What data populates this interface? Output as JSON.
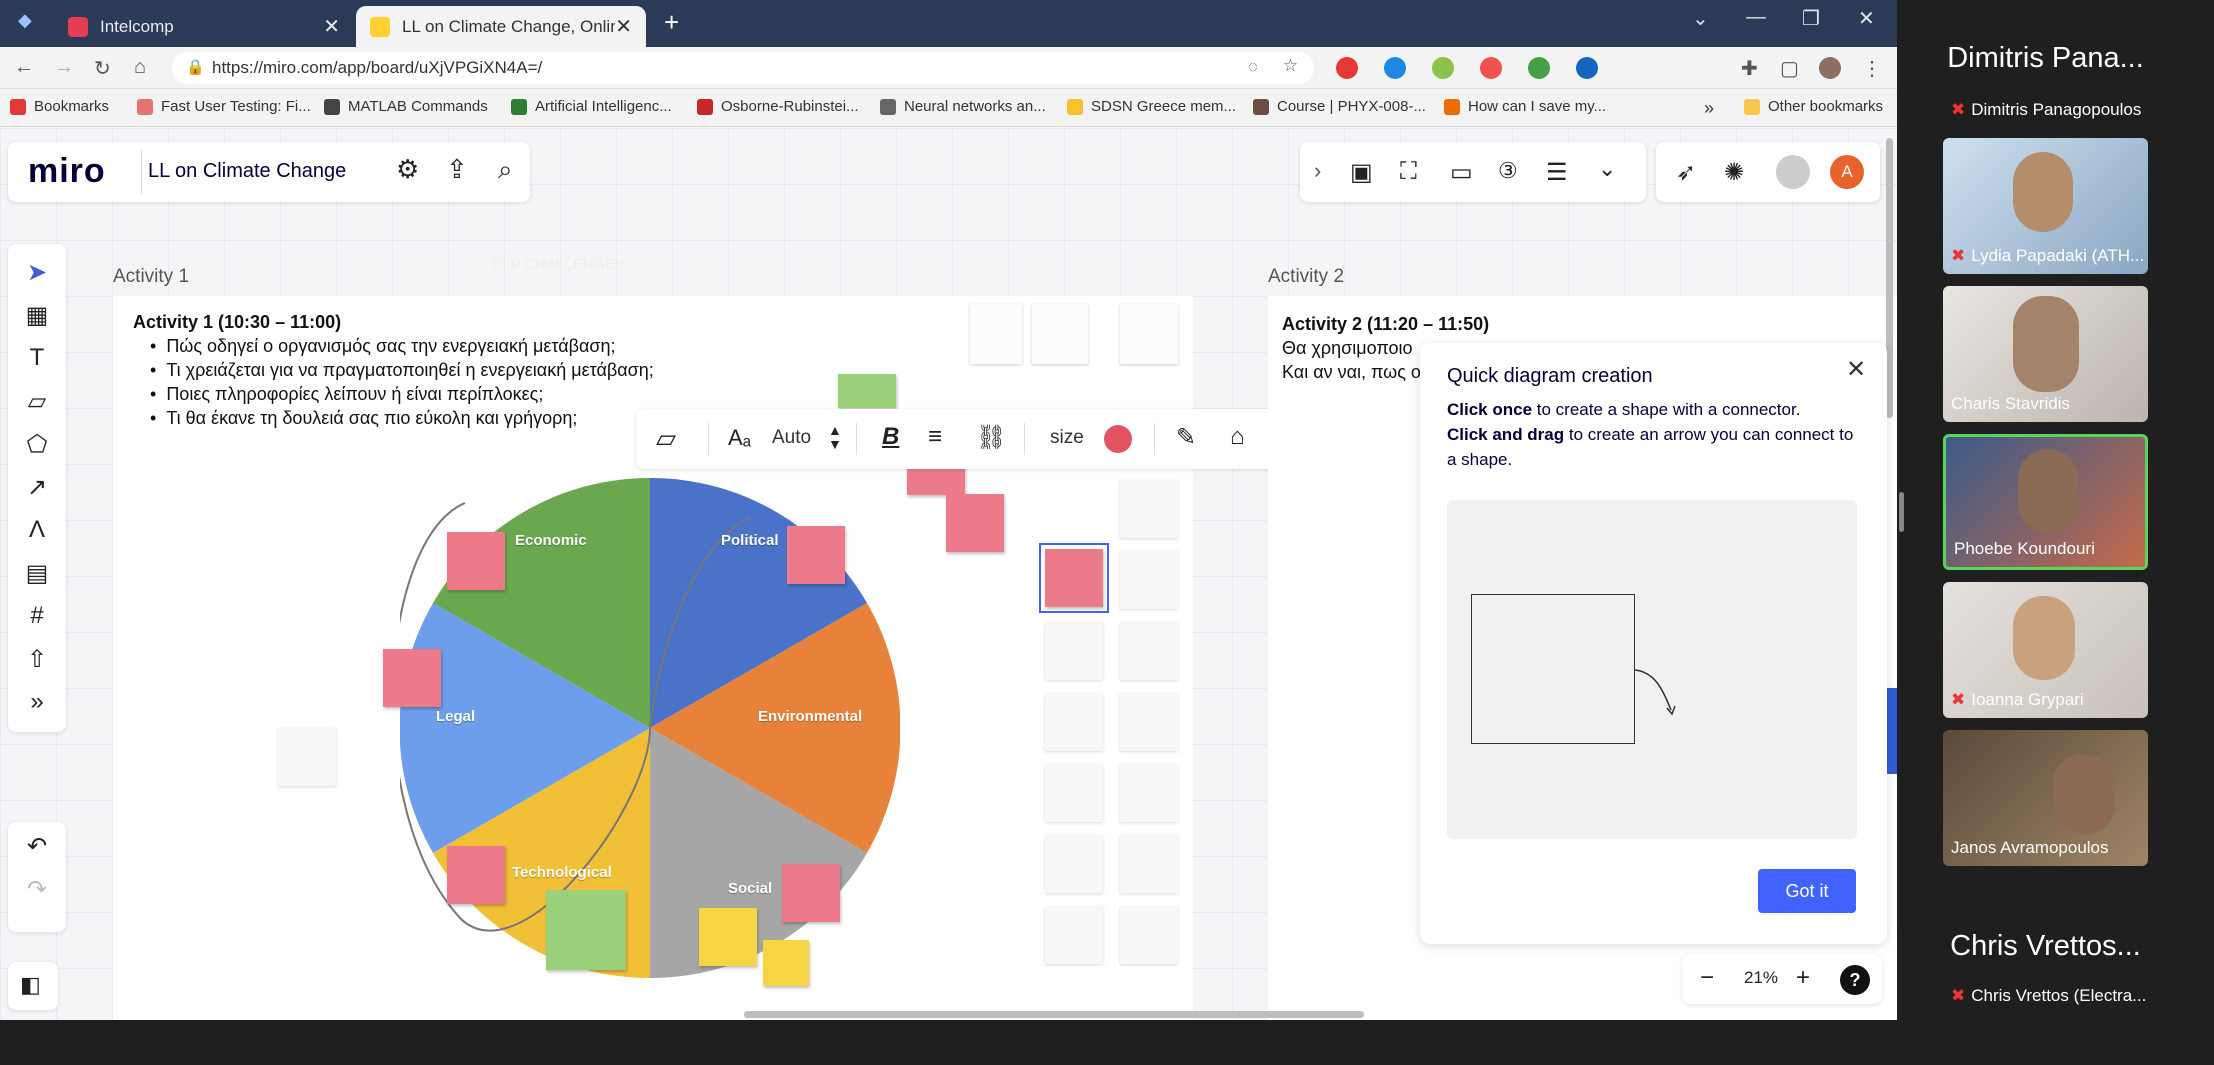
{
  "tabs": [
    {
      "label": "Intelcomp",
      "close": "✕",
      "favicon_color": "#e73c56"
    },
    {
      "label": "LL on Climate Change, Online W",
      "close": "✕",
      "favicon_color": "#ffd02f"
    }
  ],
  "new_tab": "+",
  "window_controls": {
    "dropdown": "⌄",
    "minimize": "—",
    "restore": "❐",
    "close": "✕"
  },
  "address": {
    "url": "https://miro.com/app/board/uXjVPGiXN4A=/"
  },
  "bookmarks": [
    "Bookmarks",
    "Fast User Testing: Fi...",
    "MATLAB Commands",
    "Artificial Intelligenc...",
    "Osborne-Rubinstei...",
    "Neural networks an...",
    "SDSN Greece mem...",
    "Course | PHYX-008-...",
    "How can I save my..."
  ],
  "bookmarks_more": "»",
  "other_bookmarks": "Other bookmarks",
  "miro": {
    "logo": "miro",
    "board_title": "LL on Climate Change",
    "avatar_letter": "A",
    "zoom": "21%",
    "zoom_minus": "−",
    "zoom_plus": "+",
    "help": "?"
  },
  "activity1": {
    "frame_label": "Activity 1",
    "faded": "TOP CHALLENGES",
    "title": "Activity 1 (10:30 – 11:00)",
    "bullets": [
      "Πώς οδηγεί ο οργανισμός σας την ενεργειακή μετάβαση;",
      "Τι χρειάζεται για να πραγματοποιηθεί η ενεργειακή μετάβαση;",
      "Ποιες πληροφορίες λείπουν ή είναι περίπλοκες;",
      "Τι θα έκανε τη δουλειά σας πιο εύκολη και γρήγορη;"
    ]
  },
  "activity2": {
    "frame_label": "Activity 2",
    "title": "Activity 2 (11:20 – 11:50)",
    "line1": "Θα χρησιμοποιο",
    "line2": "Και αν ναι, πως ο"
  },
  "toolbar": {
    "font_label": "Auto",
    "size_label": "size",
    "accent": "#e35463"
  },
  "pie": {
    "labels": [
      "Economic",
      "Political",
      "Legal",
      "Environmental",
      "Technological",
      "Social"
    ],
    "colors": [
      "#6aa84f",
      "#4a72c9",
      "#6d9eeb",
      "#e8823a",
      "#f2c037",
      "#a6a6a6"
    ]
  },
  "quick_diagram": {
    "title": "Quick diagram creation",
    "line1_bold": "Click once",
    "line1_rest": " to create a shape with a connector.",
    "line2_bold": "Click and drag",
    "line2_rest": " to create an arrow you can connect to a shape.",
    "button": "Got it",
    "close": "✕"
  },
  "participants": [
    {
      "big": "Dimitris Pana...",
      "name": "Dimitris Panagopoulos",
      "muted": true
    },
    {
      "name": "Lydia Papadaki (ATH...",
      "muted": true
    },
    {
      "name": "Charis Stavridis",
      "muted": false
    },
    {
      "name": "Phoebe Koundouri",
      "muted": false
    },
    {
      "name": "Ioanna Grypari",
      "muted": true
    },
    {
      "name": "Janos Avramopoulos",
      "muted": false
    },
    {
      "big": "Chris Vrettos...",
      "name": "Chris Vrettos (Electra...",
      "muted": true
    }
  ],
  "icons": {
    "mic_muted": "🎤"
  }
}
